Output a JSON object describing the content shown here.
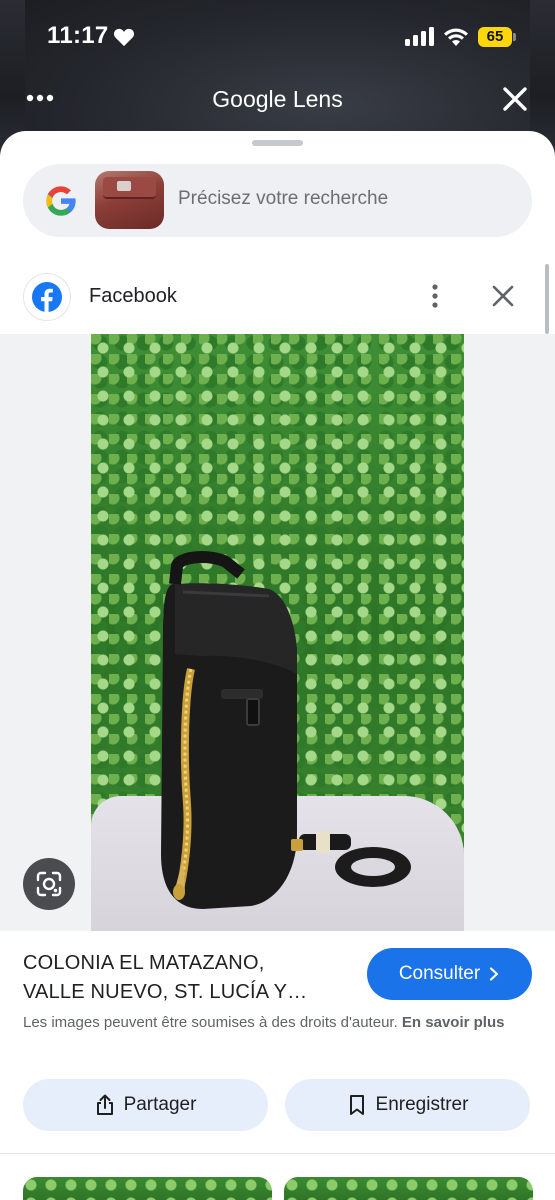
{
  "status_bar": {
    "time": "11:17",
    "battery": "65"
  },
  "header": {
    "title": "Google Lens"
  },
  "search": {
    "placeholder": "Précisez votre recherche"
  },
  "result": {
    "source_name": "Facebook",
    "title_line1": "COLONIA EL MATAZANO,",
    "title_line2": "VALLE NUEVO, ST. LUCÍA Y…",
    "consult_label": "Consulter",
    "copyright_text": "Les images peuvent être soumises à des droits d'auteur.",
    "learn_more": "En savoir plus",
    "share_label": "Partager",
    "save_label": "Enregistrer"
  },
  "colors": {
    "accent": "#1a73e8",
    "battery": "#ffd60a",
    "action_bg": "#e7eefb"
  }
}
